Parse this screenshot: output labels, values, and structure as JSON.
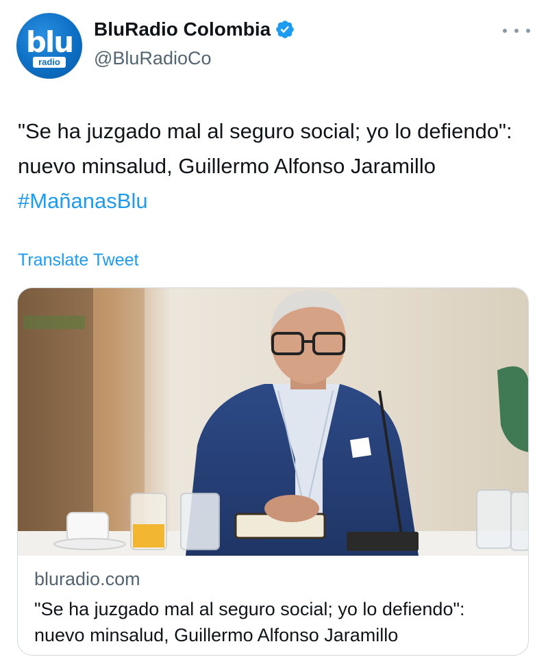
{
  "author": {
    "display_name": "BluRadio Colombia",
    "handle": "@BluRadioCo",
    "verified": true,
    "avatar": {
      "logo_text": "blu",
      "logo_tag": "radio",
      "brand_color": "#0d6fc4"
    }
  },
  "menu": {
    "icon": "more-options-icon"
  },
  "tweet": {
    "text": "\"Se ha juzgado mal al seguro social; yo lo defiendo\": nuevo minsalud, Guillermo Alfonso Jaramillo ",
    "hashtag": "#MañanasBlu",
    "translate_label": "Translate Tweet"
  },
  "card": {
    "image_description_icon": "news-photo",
    "domain": "bluradio.com",
    "title": "\"Se ha juzgado mal al seguro social; yo lo defiendo\": nuevo minsalud, Guillermo Alfonso Jaramillo"
  },
  "colors": {
    "link": "#1d9bf0",
    "secondary_text": "#536471",
    "primary_text": "#0f1419",
    "border": "#cfd9de"
  }
}
